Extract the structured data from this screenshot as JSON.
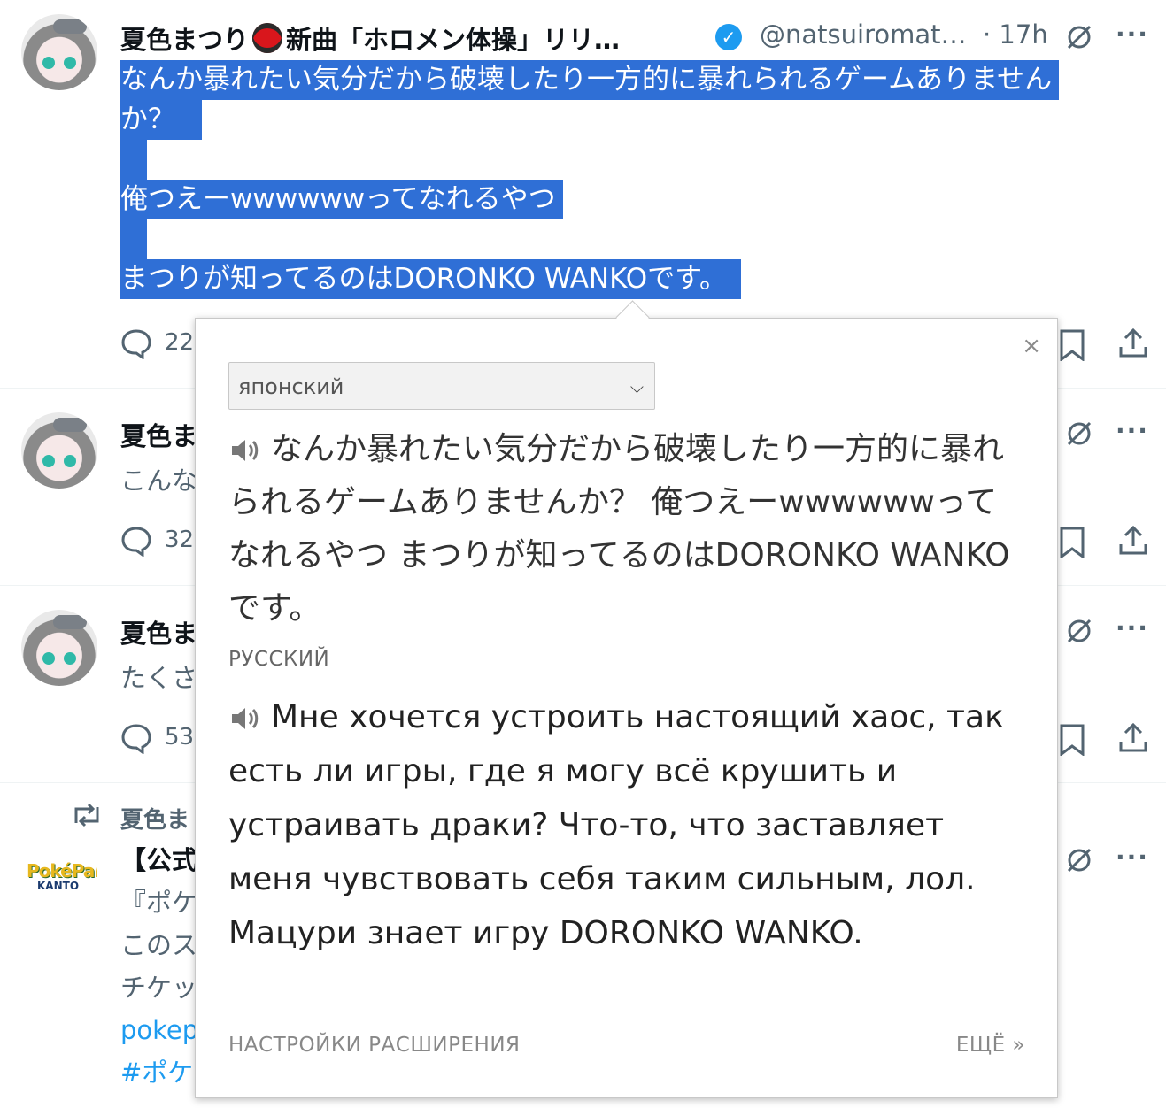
{
  "tweets": [
    {
      "name": "夏色まつり",
      "name_rest": "新曲「ホロメン体操」リリ…",
      "handle": "@natsuiromat…",
      "time": "· 17h",
      "lines": [
        "なんか暴れたい気分だから破壊したり一方的に暴れられるゲームありません",
        "か？",
        "俺つえーwwwwwwってなれるやつ",
        "まつりが知ってるのはDORONKO WANKOです。"
      ],
      "reply_count": "22"
    },
    {
      "name": "夏色ま",
      "snippet": "こんな",
      "reply_count": "32"
    },
    {
      "name": "夏色ま",
      "snippet": "たくさ",
      "reply_count": "53"
    },
    {
      "retweeted_by": "夏色ま",
      "title": "【公式",
      "lines": [
        "『ポケ",
        "このス",
        "チケッ",
        "pokep",
        "#ポケ"
      ],
      "avatar_logo": "PokéPark",
      "avatar_sub": "KANTO"
    }
  ],
  "translator": {
    "source_language": "японский",
    "source_text": "なんか暴れたい気分だから破壊したり一方的に暴れられるゲームありませんか？ 俺つえーwwwwwwってなれるやつ まつりが知ってるのはDORONKO WANKOです。",
    "target_language": "РУССКИЙ",
    "target_text": "Мне хочется устроить настоящий хаос, так есть ли игры, где я могу всё крушить и устраивать драки? Что-то, что заставляет меня чувствовать себя таким сильным, лол. Мацури знает игру DORONKO WANKO.",
    "close": "×",
    "settings_link": "НАСТРОЙКИ РАСШИРЕНИЯ",
    "more_link": "ЕЩЁ »"
  },
  "colors": {
    "selection": "#2f6fd6",
    "link": "#1d9bf0",
    "verified": "#1d9bf0"
  }
}
